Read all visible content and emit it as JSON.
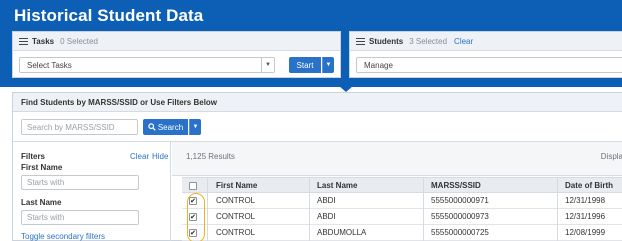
{
  "app": {
    "title": "Historical Student Data"
  },
  "tasks": {
    "title": "Tasks",
    "selected": "0 Selected",
    "select_value": "Select Tasks",
    "start_label": "Start"
  },
  "students": {
    "title": "Students",
    "selected": "3 Selected",
    "clear_label": "Clear",
    "manage_value": "Manage"
  },
  "find": {
    "title": "Find Students by MARSS/SSID or Use Filters Below",
    "search_placeholder": "Search by MARSS/SSID",
    "search_label": "Search"
  },
  "filters": {
    "title": "Filters",
    "clear_label": "Clear",
    "hide_label": "Hide",
    "first_name_label": "First Name",
    "first_name_placeholder": "Starts with",
    "last_name_label": "Last Name",
    "last_name_placeholder": "Starts with",
    "toggle_label": "Toggle secondary filters"
  },
  "results": {
    "count": "1,125 Results",
    "display_label": "Displa",
    "columns": [
      "First Name",
      "Last Name",
      "MARSS/SSID",
      "Date of Birth"
    ],
    "rows": [
      {
        "checked": true,
        "first": "CONTROL",
        "last": "ABDI",
        "ssid": "5555000000971",
        "dob": "12/31/1998"
      },
      {
        "checked": true,
        "first": "CONTROL",
        "last": "ABDI",
        "ssid": "5555000000973",
        "dob": "12/31/1996"
      },
      {
        "checked": true,
        "first": "CONTROL",
        "last": "ABDUMOLLA",
        "ssid": "5555000000725",
        "dob": "12/08/1999"
      }
    ]
  },
  "colors": {
    "header_blue": "#0d5fb5",
    "button_blue": "#2a72c8",
    "highlight": "#f2b31a"
  }
}
